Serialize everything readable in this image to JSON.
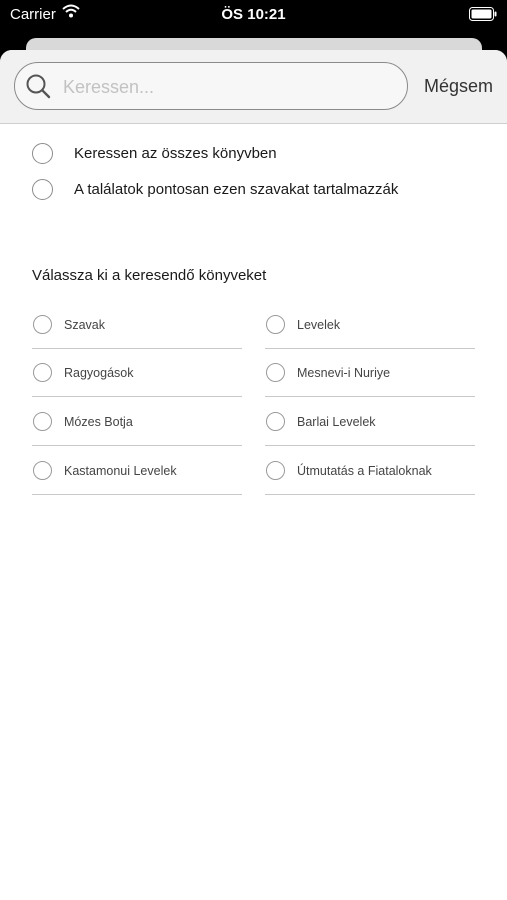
{
  "status_bar": {
    "carrier": "Carrier",
    "time": "ÖS 10:21"
  },
  "search": {
    "placeholder": "Keressen...",
    "value": "",
    "cancel_label": "Mégsem"
  },
  "search_options": [
    {
      "label": "Keressen az összes könyvben"
    },
    {
      "label": "A találatok pontosan ezen szavakat tartalmazzák"
    }
  ],
  "books_section": {
    "title": "Válassza ki a keresendő könyveket",
    "left_column": [
      {
        "label": "Szavak"
      },
      {
        "label": "Ragyogások"
      },
      {
        "label": "Mózes Botja"
      },
      {
        "label": "Kastamonui Levelek"
      }
    ],
    "right_column": [
      {
        "label": "Levelek"
      },
      {
        "label": "Mesnevi-i Nuriye"
      },
      {
        "label": "Barlai Levelek"
      },
      {
        "label": "Útmutatás a Fiataloknak"
      }
    ]
  }
}
